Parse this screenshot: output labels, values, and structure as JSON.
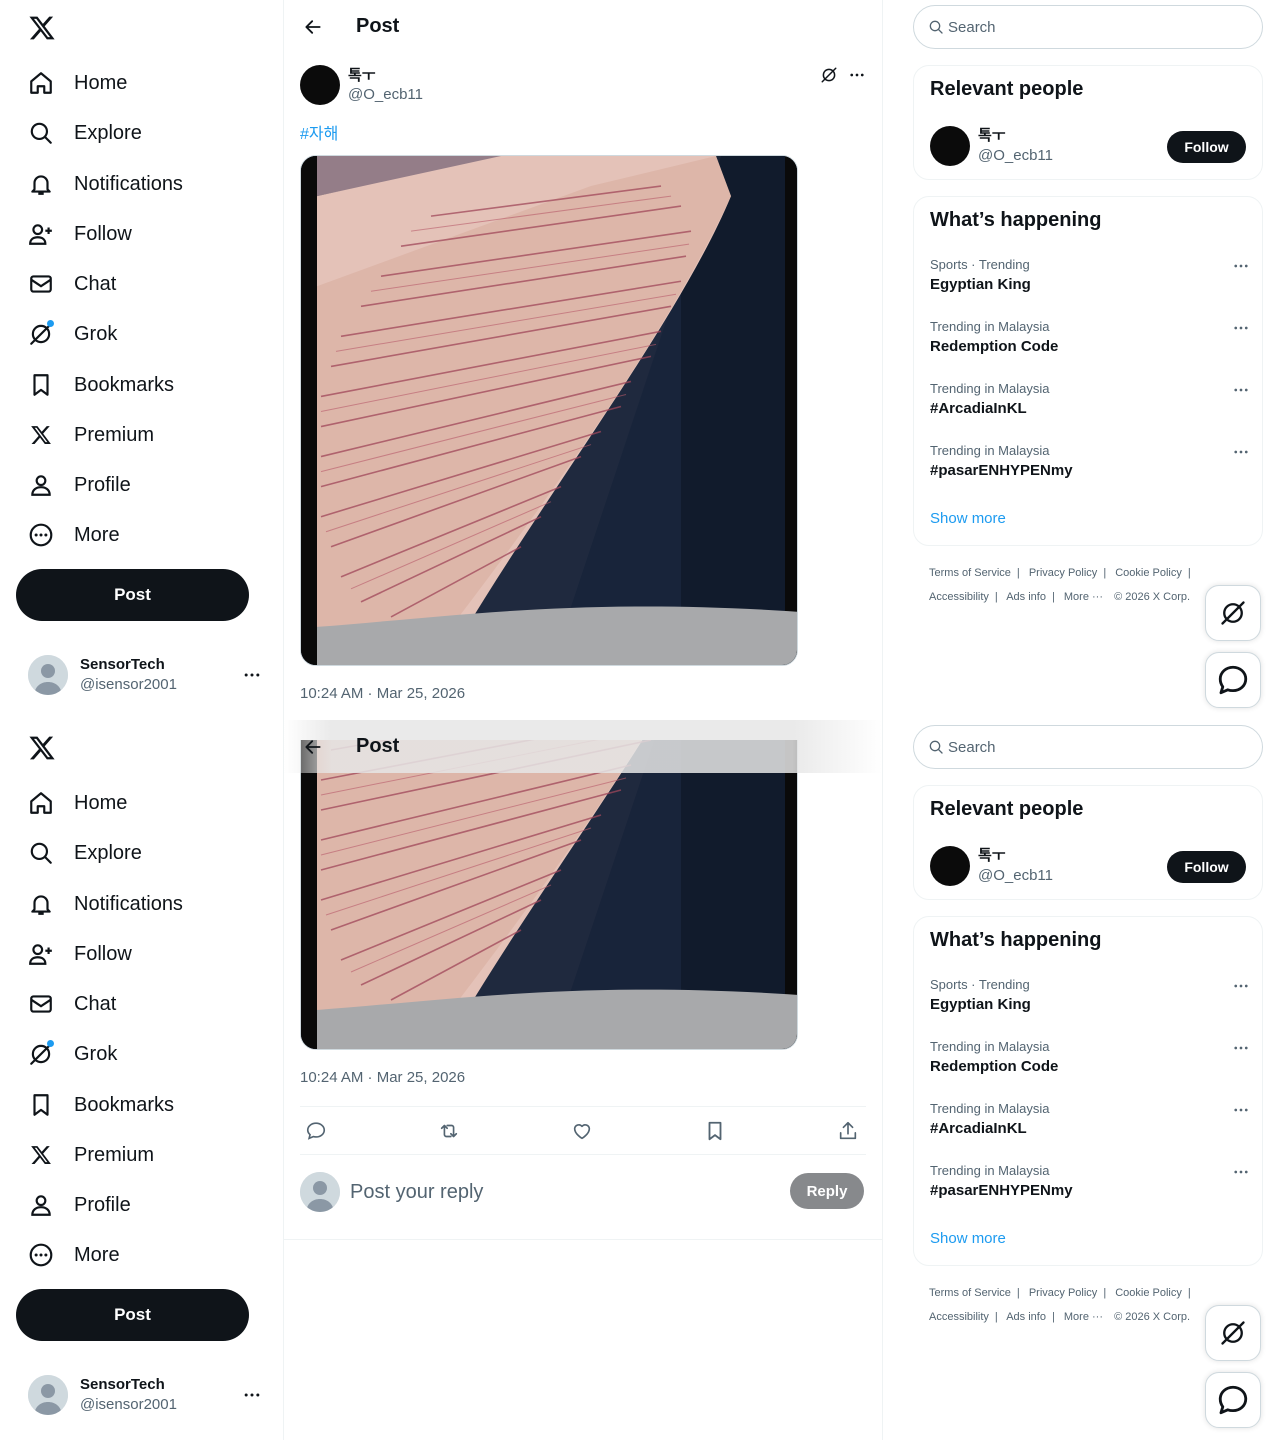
{
  "nav": {
    "items": [
      {
        "label": "Home",
        "icon": "home-icon"
      },
      {
        "label": "Explore",
        "icon": "search-icon"
      },
      {
        "label": "Notifications",
        "icon": "bell-icon"
      },
      {
        "label": "Follow",
        "icon": "person-plus-icon"
      },
      {
        "label": "Chat",
        "icon": "envelope-icon"
      },
      {
        "label": "Grok",
        "icon": "grok-icon"
      },
      {
        "label": "Bookmarks",
        "icon": "bookmark-icon"
      },
      {
        "label": "Premium",
        "icon": "x-logo-icon"
      },
      {
        "label": "Profile",
        "icon": "person-icon"
      },
      {
        "label": "More",
        "icon": "more-circle-icon"
      }
    ],
    "post_label": "Post"
  },
  "account": {
    "name": "SensorTech",
    "handle": "@isensor2001"
  },
  "main": {
    "header_title": "Post",
    "author": {
      "name": "톡ㅜ",
      "handle": "@O_ecb11"
    },
    "hashtag": "#자해",
    "timestamp": "10:24 AM · Mar 25, 2026",
    "reply_placeholder": "Post your reply",
    "reply_label": "Reply"
  },
  "sidebar": {
    "search_placeholder": "Search",
    "relevant_title": "Relevant people",
    "person": {
      "name": "톡ㅜ",
      "handle": "@O_ecb11",
      "follow_label": "Follow"
    },
    "happening_title": "What’s happening",
    "trends": [
      {
        "meta": "Sports · Trending",
        "name": "Egyptian King"
      },
      {
        "meta": "Trending in Malaysia",
        "name": "Redemption Code"
      },
      {
        "meta": "Trending in Malaysia",
        "name": "#ArcadiaInKL"
      },
      {
        "meta": "Trending in Malaysia",
        "name": "#pasarENHYPENmy"
      }
    ],
    "show_more": "Show more",
    "footer": {
      "terms": "Terms of Service",
      "privacy": "Privacy Policy",
      "cookie": "Cookie Policy",
      "accessibility": "Accessibility",
      "ads": "Ads info",
      "more": "More ···",
      "copyright": "© 2026 X Corp."
    }
  },
  "colors": {
    "accent": "#1d9bf0",
    "text": "#0f1419",
    "muted": "#536471",
    "reply_button": "#87898c"
  }
}
